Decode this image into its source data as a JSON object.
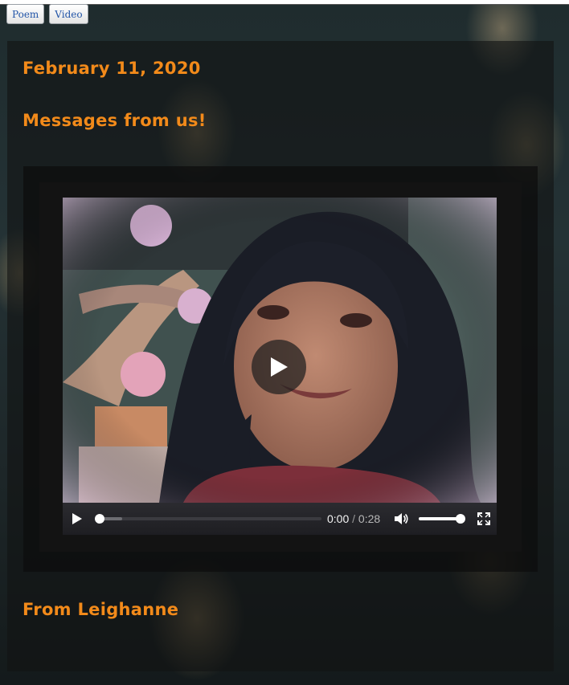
{
  "nav": {
    "poem_label": "Poem",
    "video_label": "Video"
  },
  "content": {
    "date": "February 11, 2020",
    "heading": "Messages from us!",
    "from": "From Leighanne"
  },
  "video": {
    "current_time": "0:00",
    "separator": "/",
    "duration": "0:28",
    "progress": 0.0,
    "buffered": 0.12,
    "volume": 1.0,
    "icons": {
      "overlay": "play-icon",
      "play": "play-icon",
      "volume": "volume-icon",
      "fullscreen": "fullscreen-icon"
    }
  },
  "colors": {
    "heading_accent": "#f28a1a",
    "nav_link": "#2456a8"
  }
}
